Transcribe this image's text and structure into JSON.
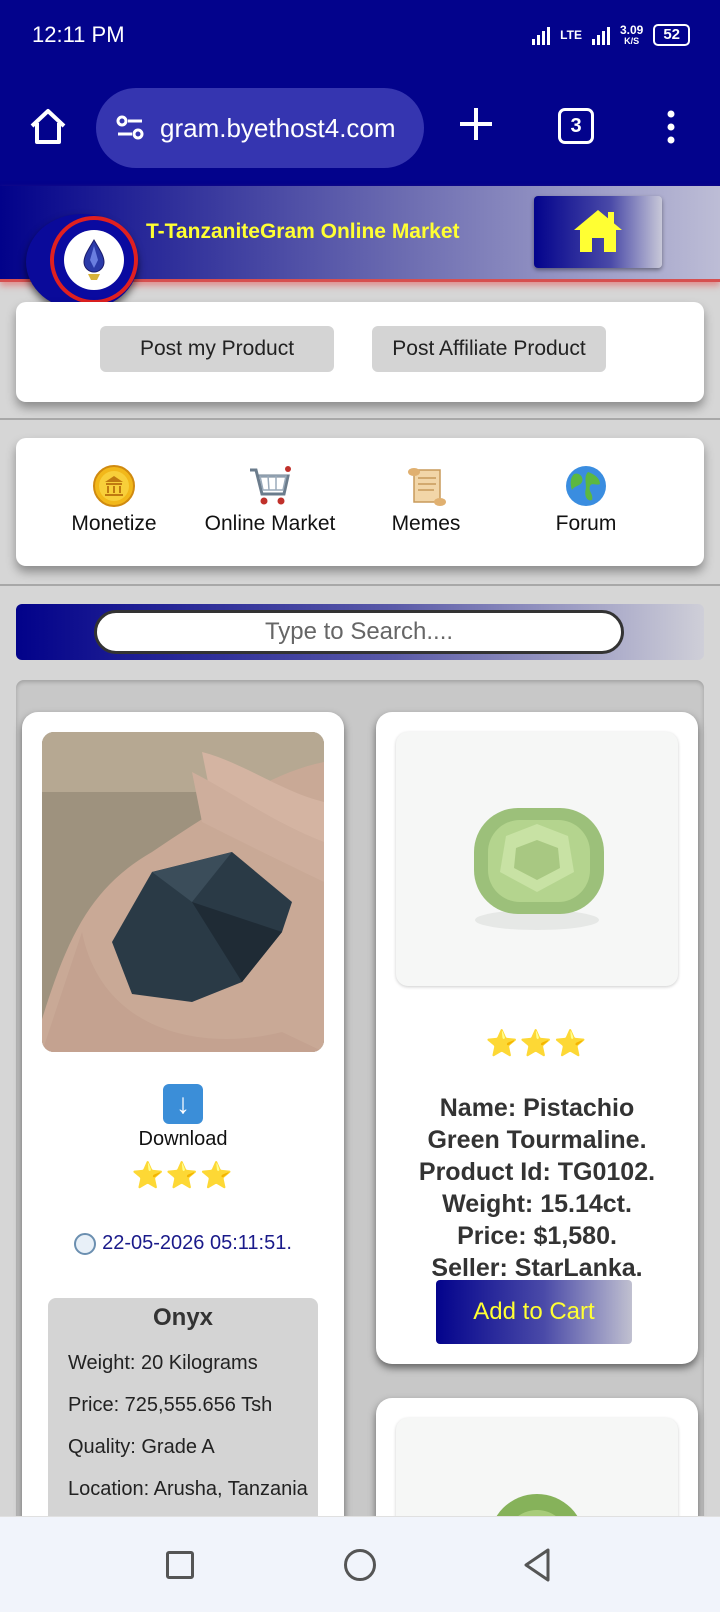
{
  "status": {
    "time": "12:11 PM",
    "network": "LTE",
    "speed_value": "3.09",
    "speed_unit": "K/S",
    "battery": "52"
  },
  "browser": {
    "url": "gram.byethost4.com",
    "tab_count": "3"
  },
  "header": {
    "title": "T-TanzaniteGram Online Market"
  },
  "post": {
    "my_product": "Post my Product",
    "affiliate_product": "Post Affiliate Product"
  },
  "nav": {
    "items": [
      {
        "label": "Monetize",
        "icon": "coin-icon"
      },
      {
        "label": "Online Market",
        "icon": "shopping-cart-icon"
      },
      {
        "label": "Memes",
        "icon": "scroll-icon"
      },
      {
        "label": "Forum",
        "icon": "globe-icon"
      }
    ]
  },
  "search": {
    "placeholder": "Type to Search...."
  },
  "products": [
    {
      "download_label": "Download",
      "stars": "⭐⭐⭐",
      "rating": 3,
      "date": "22-05-2026 05:11:51.",
      "name": "Onyx",
      "weight": "Weight: 20 Kilograms",
      "price": "Price: 725,555.656 Tsh",
      "quality": "Quality: Grade A",
      "location": "Location: Arusha, Tanzania"
    },
    {
      "stars": "⭐⭐⭐",
      "rating": 3,
      "name": "Name: Pistachio Green Tourmaline.",
      "product_id": "Product Id: TG0102.",
      "weight": "Weight: 15.14ct.",
      "price": "Price: $1,580.",
      "seller": "Seller: StarLanka.",
      "cart_label": "Add to Cart"
    }
  ],
  "colors": {
    "brand_blue": "#03038c",
    "accent_yellow": "#ffff33",
    "star": "#f2c21a"
  }
}
